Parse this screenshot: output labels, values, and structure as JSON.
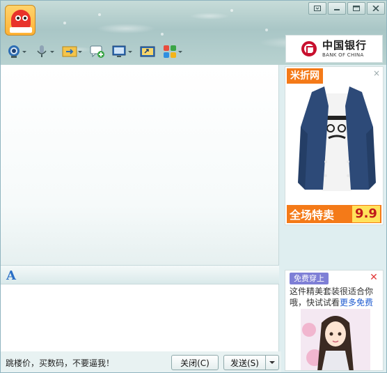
{
  "window": {
    "controls": [
      {
        "name": "menu",
        "icon": "dropdown-menu-icon"
      },
      {
        "name": "minimize",
        "icon": "minimize-icon"
      },
      {
        "name": "maximize",
        "icon": "maximize-icon"
      },
      {
        "name": "close",
        "icon": "close-icon"
      }
    ]
  },
  "toolbar": {
    "tools": [
      {
        "icon": "webcam-icon"
      },
      {
        "icon": "microphone-icon"
      },
      {
        "icon": "send-file-icon"
      },
      {
        "icon": "create-discussion-icon"
      },
      {
        "icon": "remote-desktop-icon"
      },
      {
        "icon": "screen-share-icon"
      },
      {
        "icon": "apps-grid-icon"
      }
    ]
  },
  "header_ad": {
    "name_cn": "中国银行",
    "name_en": "BANK OF CHINA",
    "brand_color": "#c8102e"
  },
  "side_ad_top": {
    "brand": "米折网",
    "banner": "全场特卖",
    "price": "9.9",
    "close": "×",
    "accent": "#f47a18"
  },
  "side_ad_bottom": {
    "tag": "免费穿上",
    "text": "这件精美套装很适合你哦，快试试看",
    "link": "更多免费",
    "close": "✕"
  },
  "format_bar": {
    "font_icon": "A"
  },
  "bottom": {
    "status": "跳楼价，买数码，不要逼我！",
    "close_label": "关闭(C)",
    "send_label": "发送(S)"
  }
}
